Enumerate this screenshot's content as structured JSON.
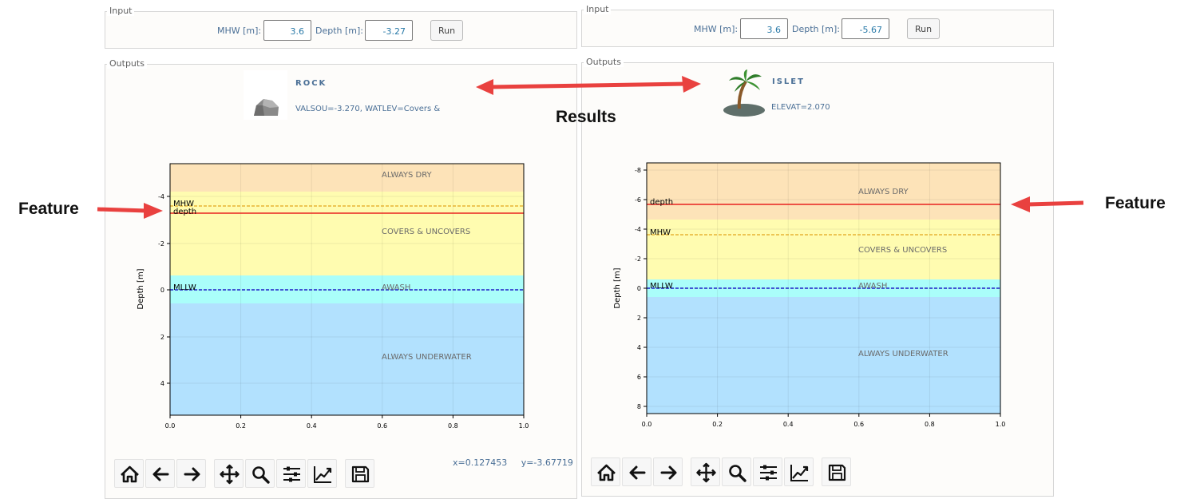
{
  "panels": [
    {
      "input": {
        "legend": "Input",
        "mhw_label": "MHW [m]:",
        "mhw_value": "3.6",
        "depth_label": "Depth [m]:",
        "depth_value": "-3.27",
        "run_label": "Run"
      },
      "outputs": {
        "legend": "Outputs",
        "feature_title": "ROCK",
        "feature_icon": "rock-icon",
        "feature_attr": "VALSOU=-3.270, WATLEV=Covers &"
      },
      "chart": {
        "ylabel": "Depth [m]",
        "yticks": [
          "-4",
          "-2",
          "0",
          "2",
          "4"
        ],
        "xticks": [
          "0.0",
          "0.2",
          "0.4",
          "0.6",
          "0.8",
          "1.0"
        ],
        "zones": [
          "ALWAYS DRY",
          "COVERS & UNCOVERS",
          "AWASH",
          "ALWAYS UNDERWATER"
        ],
        "line_labels": {
          "mhw": "MHW",
          "depth": "depth",
          "mllw": "MLLW"
        }
      },
      "toolbar_coords": "x=0.127453     y=-3.67719"
    },
    {
      "input": {
        "legend": "Input",
        "mhw_label": "MHW [m]:",
        "mhw_value": "3.6",
        "depth_label": "Depth [m]:",
        "depth_value": "-5.67",
        "run_label": "Run"
      },
      "outputs": {
        "legend": "Outputs",
        "feature_title": "ISLET",
        "feature_icon": "islet-palm-icon",
        "feature_attr": "ELEVAT=2.070"
      },
      "chart": {
        "ylabel": "Depth [m]",
        "yticks": [
          "-8",
          "-6",
          "-4",
          "-2",
          "0",
          "2",
          "4",
          "6",
          "8"
        ],
        "xticks": [
          "0.0",
          "0.2",
          "0.4",
          "0.6",
          "0.8",
          "1.0"
        ],
        "zones": [
          "ALWAYS DRY",
          "COVERS & UNCOVERS",
          "AWASH",
          "ALWAYS UNDERWATER"
        ],
        "line_labels": {
          "mhw": "MHW",
          "depth": "depth",
          "mllw": "MLLW"
        }
      },
      "toolbar_coords": ""
    }
  ],
  "annotations": {
    "results": "Results",
    "feature_left": "Feature",
    "feature_right": "Feature"
  },
  "toolbar_icons": [
    "home-icon",
    "back-arrow-icon",
    "forward-arrow-icon",
    "pan-icon",
    "zoom-icon",
    "configure-subplots-icon",
    "edit-axis-icon",
    "save-icon"
  ],
  "colors": {
    "always_dry": "#fde3b8",
    "covers_uncovers": "#fffcb0",
    "awash": "#aafefa",
    "always_underwater": "#b2e1fe",
    "depth_line": "#e8231f",
    "mhw_line": "#e2a51c",
    "mllw_line": "#1e1ec8",
    "annotation_arrow": "#e9413f"
  }
}
